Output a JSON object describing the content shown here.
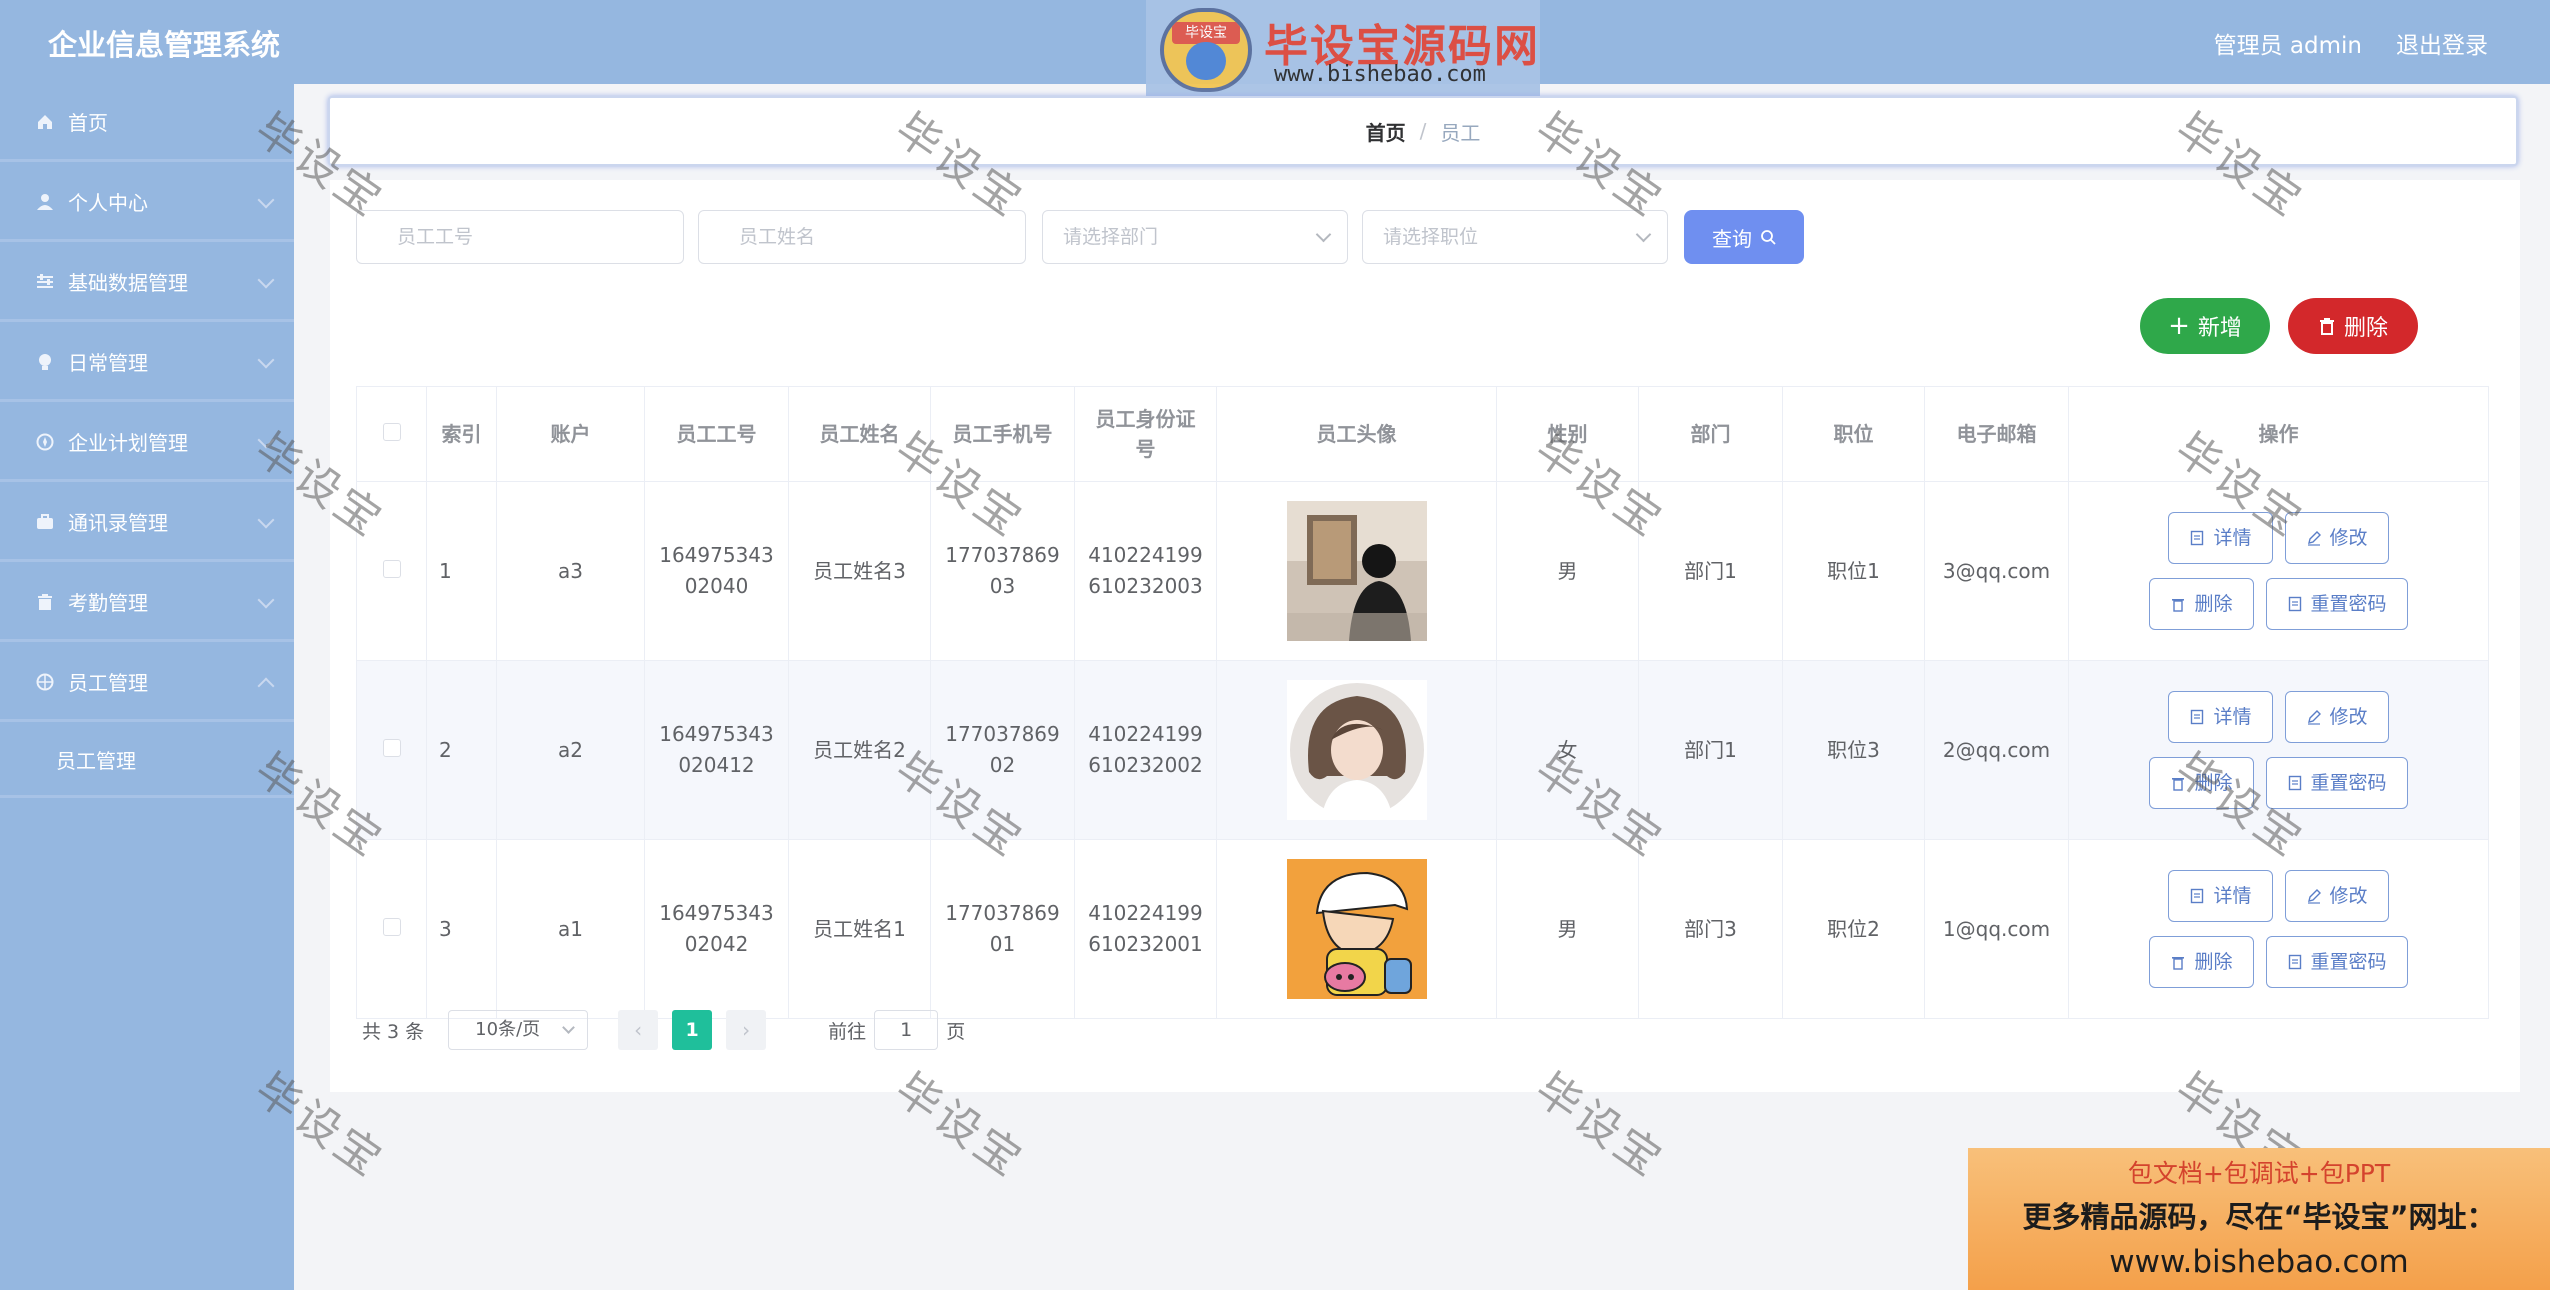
{
  "header": {
    "app_title": "企业信息管理系统",
    "user_label": "管理员 admin",
    "logout_label": "退出登录",
    "logo_badge": "毕设宝",
    "logo_title": "毕设宝源码网",
    "logo_url": "www.bishebao.com"
  },
  "sidebar": {
    "items": [
      {
        "label": "首页",
        "icon": "home-icon"
      },
      {
        "label": "个人中心",
        "icon": "user-icon"
      },
      {
        "label": "基础数据管理",
        "icon": "sliders-icon"
      },
      {
        "label": "日常管理",
        "icon": "bulb-icon"
      },
      {
        "label": "企业计划管理",
        "icon": "compass-icon"
      },
      {
        "label": "通讯录管理",
        "icon": "briefcase-icon"
      },
      {
        "label": "考勤管理",
        "icon": "trash-icon"
      },
      {
        "label": "员工管理",
        "icon": "globe-icon"
      }
    ],
    "sub_item": "员工管理"
  },
  "breadcrumb": {
    "home": "首页",
    "separator": "/",
    "current": "员工"
  },
  "search": {
    "emp_no_placeholder": "员工工号",
    "emp_name_placeholder": "员工姓名",
    "dept_placeholder": "请选择部门",
    "position_placeholder": "请选择职位",
    "query_label": "查询"
  },
  "actions": {
    "add_label": "新增",
    "delete_label": "删除"
  },
  "table": {
    "headers": [
      "索引",
      "账户",
      "员工工号",
      "员工姓名",
      "员工手机号",
      "员工身份证号",
      "员工头像",
      "性别",
      "部门",
      "职位",
      "电子邮箱",
      "操作"
    ],
    "rows": [
      {
        "index": "1",
        "account": "a3",
        "emp_no_1": "164975343",
        "emp_no_2": "02040",
        "name": "员工姓名3",
        "phone_1": "177037869",
        "phone_2": "03",
        "id_1": "410224199",
        "id_2": "610232003",
        "gender": "男",
        "dept": "部门1",
        "position": "职位1",
        "email": "3@qq.com"
      },
      {
        "index": "2",
        "account": "a2",
        "emp_no_1": "164975343",
        "emp_no_2": "020412",
        "name": "员工姓名2",
        "phone_1": "177037869",
        "phone_2": "02",
        "id_1": "410224199",
        "id_2": "610232002",
        "gender": "女",
        "dept": "部门1",
        "position": "职位3",
        "email": "2@qq.com"
      },
      {
        "index": "3",
        "account": "a1",
        "emp_no_1": "164975343",
        "emp_no_2": "02042",
        "name": "员工姓名1",
        "phone_1": "177037869",
        "phone_2": "01",
        "id_1": "410224199",
        "id_2": "610232001",
        "gender": "男",
        "dept": "部门3",
        "position": "职位2",
        "email": "1@qq.com"
      }
    ],
    "op_detail": "详情",
    "op_edit": "修改",
    "op_delete": "删除",
    "op_reset": "重置密码"
  },
  "pagination": {
    "total": "共 3 条",
    "page_size": "10条/页",
    "prev": "‹",
    "current_page": "1",
    "next": "›",
    "goto_prefix": "前往",
    "goto_value": "1",
    "goto_suffix": "页"
  },
  "watermark": "毕设宝",
  "promo": {
    "line1": "包文档+包调试+包PPT",
    "line2": "更多精品源码，尽在“毕设宝”网址：",
    "line3": "www.bishebao.com"
  },
  "colors": {
    "header_bg": "#95b7e0",
    "accent": "#6f8ff0",
    "add_green": "#2fa84a",
    "delete_red": "#d3282b",
    "page_active": "#1fbf9b"
  }
}
